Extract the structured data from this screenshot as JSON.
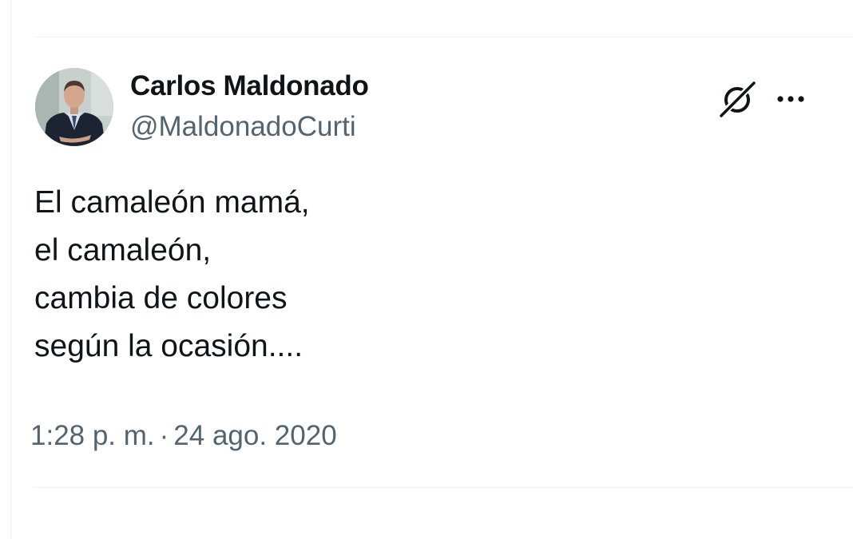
{
  "tweet": {
    "author": {
      "display_name": "Carlos Maldonado",
      "handle": "@MaldonadoCurti"
    },
    "icons": {
      "grok": "grok-icon",
      "more": "more-options-icon"
    },
    "text_lines": [
      "El camaleón mamá,",
      "el camaleón,",
      "cambia de colores",
      "según la ocasión...."
    ],
    "time": "1:28 p. m.",
    "separator": "·",
    "date": "24 ago. 2020"
  },
  "colors": {
    "text_primary": "#0f1419",
    "text_secondary": "#536471",
    "divider": "#eff3f4"
  }
}
